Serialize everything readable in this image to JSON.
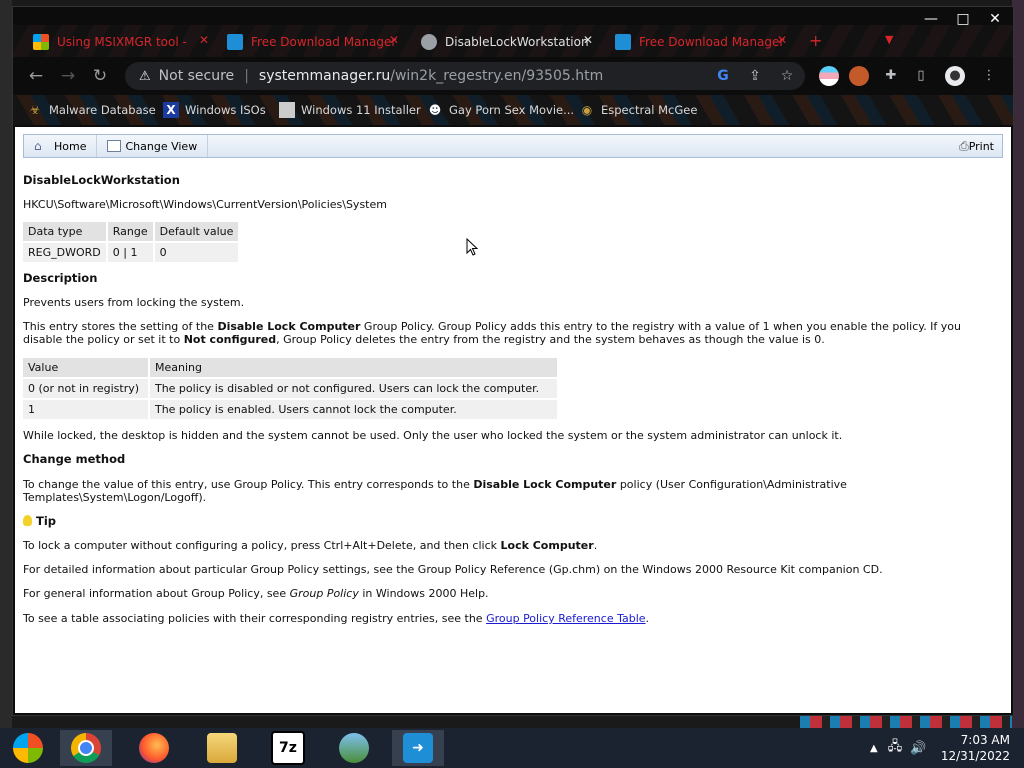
{
  "browser": {
    "tabs": [
      {
        "title": "Using MSIXMGR tool -",
        "active": false
      },
      {
        "title": "Free Download Manager",
        "active": false
      },
      {
        "title": "DisableLockWorkstation",
        "active": true
      },
      {
        "title": "Free Download Manager",
        "active": false
      }
    ],
    "new_tab_label": "+",
    "window_controls": {
      "minimize": "—",
      "maximize": "□",
      "close": "✕"
    },
    "address": {
      "security_label": "Not secure",
      "url_host": "systemmanager.ru",
      "url_path": "/win2k_regestry.en/93505.htm"
    },
    "bookmarks": [
      {
        "label": "Malware Database",
        "icon": "malware-icon"
      },
      {
        "label": "Windows ISOs",
        "icon": "x-logo-icon"
      },
      {
        "label": "Windows 11 Installer",
        "icon": "installer-icon"
      },
      {
        "label": "Gay Porn Sex Movie...",
        "icon": "site-icon"
      },
      {
        "label": "Espectral McGee",
        "icon": "eye-icon"
      }
    ]
  },
  "page": {
    "toolbar": {
      "home": "Home",
      "change_view": "Change View",
      "print": "Print"
    },
    "title": "DisableLockWorkstation",
    "registry_path": "HKCU\\Software\\Microsoft\\Windows\\CurrentVersion\\Policies\\System",
    "type_table": {
      "headers": [
        "Data type",
        "Range",
        "Default value"
      ],
      "row": [
        "REG_DWORD",
        "0 | 1",
        "0"
      ]
    },
    "description_heading": "Description",
    "description_short": "Prevents users from locking the system.",
    "description_long": {
      "t1": "This entry stores the setting of the ",
      "b1": "Disable Lock Computer",
      "t2": " Group Policy. Group Policy adds this entry to the registry with a value of 1 when you enable the policy. If you disable the policy or set it to ",
      "b2": "Not configured",
      "t3": ", Group Policy deletes the entry from the registry and the system behaves as though the value is 0."
    },
    "value_table": {
      "headers": [
        "Value",
        "Meaning"
      ],
      "rows": [
        [
          "0 (or not in registry)",
          "The policy is disabled or not configured. Users can lock the computer."
        ],
        [
          "1",
          "The policy is enabled. Users cannot lock the computer."
        ]
      ]
    },
    "locked_note": "While locked, the desktop is hidden and the system cannot be used. Only the user who locked the system or the system administrator can unlock it.",
    "change_heading": "Change method",
    "change_text": {
      "t1": "To change the value of this entry, use Group Policy. This entry corresponds to the ",
      "b1": "Disable Lock Computer",
      "t2": " policy (User Configuration\\Administrative Templates\\System\\Logon/Logoff)."
    },
    "tip_heading": "Tip",
    "tip_text": {
      "t1": "To lock a computer without configuring a policy, press Ctrl+Alt+Delete, and then click ",
      "b1": "Lock Computer",
      "t2": "."
    },
    "info1": "For detailed information about particular Group Policy settings, see the Group Policy Reference (Gp.chm) on the Windows 2000 Resource Kit companion CD.",
    "info2": {
      "t1": "For general information about Group Policy, see ",
      "i1": "Group Policy",
      "t2": " in Windows 2000 Help."
    },
    "info3": {
      "t1": "To see a table associating policies with their corresponding registry entries, see the ",
      "link": "Group Policy Reference Table",
      "t2": "."
    }
  },
  "taskbar": {
    "apps": [
      "start-icon",
      "chrome-icon",
      "firefox-icon",
      "file-explorer-icon",
      "7zip-icon",
      "network-users-icon",
      "download-manager-icon"
    ],
    "sevenzip_label": "7z",
    "clock": {
      "time": "7:03 AM",
      "date": "12/31/2022"
    }
  },
  "colors": {
    "tab_text": "#d6262b",
    "link": "#1a1ad0",
    "taskbar": "#1b2230"
  }
}
